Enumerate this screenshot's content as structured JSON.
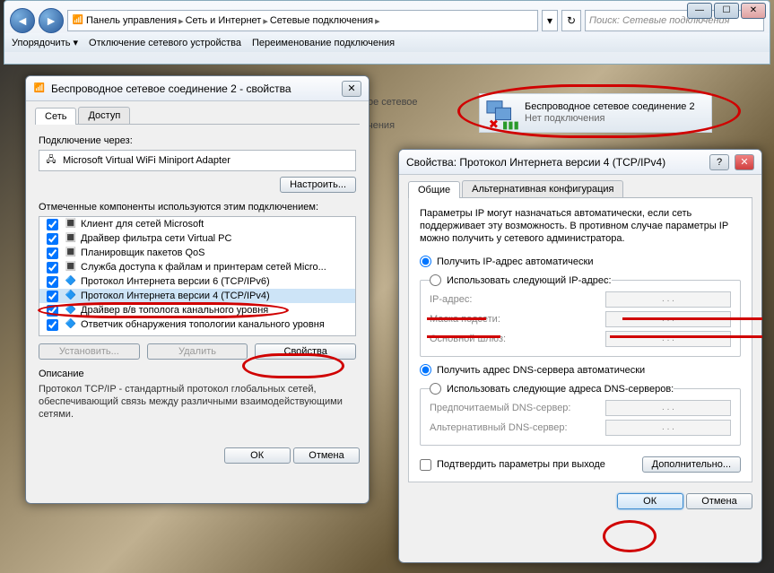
{
  "explorer": {
    "breadcrumb": [
      "Панель управления",
      "Сеть и Интернет",
      "Сетевые подключения"
    ],
    "search_placeholder": "Поиск: Сетевые подключения",
    "toolbar": {
      "organize": "Упорядочить",
      "disable": "Отключение сетевого устройства",
      "rename": "Переименование подключения"
    }
  },
  "bg_items": {
    "item1_line1": "ое сетевое",
    "item1_line2": "чения"
  },
  "connection": {
    "name": "Беспроводное сетевое соединение 2",
    "status": "Нет подключения"
  },
  "props_dialog": {
    "title": "Беспроводное сетевое соединение 2 - свойства",
    "tabs": {
      "network": "Сеть",
      "access": "Доступ"
    },
    "connect_via": "Подключение через:",
    "adapter": "Microsoft Virtual WiFi Miniport Adapter",
    "configure": "Настроить...",
    "components_label": "Отмеченные компоненты используются этим подключением:",
    "components": [
      "Клиент для сетей Microsoft",
      "Драйвер фильтра сети Virtual PC",
      "Планировщик пакетов QoS",
      "Служба доступа к файлам и принтерам сетей Micro...",
      "Протокол Интернета версии 6 (TCP/IPv6)",
      "Протокол Интернета версии 4 (TCP/IPv4)",
      "Драйвер в/в тополога канального уровня",
      "Ответчик обнаружения топологии канального уровня"
    ],
    "install": "Установить...",
    "remove": "Удалить",
    "properties": "Свойства",
    "description_label": "Описание",
    "description": "Протокол TCP/IP - стандартный протокол глобальных сетей, обеспечивающий связь между различными взаимодействующими сетями.",
    "ok": "ОК",
    "cancel": "Отмена"
  },
  "ip_dialog": {
    "title": "Свойства: Протокол Интернета версии 4 (TCP/IPv4)",
    "tabs": {
      "general": "Общие",
      "alt": "Альтернативная конфигурация"
    },
    "intro": "Параметры IP могут назначаться автоматически, если сеть поддерживает эту возможность. В противном случае параметры IP можно получить у сетевого администратора.",
    "auto_ip": "Получить IP-адрес автоматически",
    "use_ip": "Использовать следующий IP-адрес:",
    "ip_address": "IP-адрес:",
    "mask": "Маска подсети:",
    "gateway": "Основной шлюз:",
    "dot_placeholder": ".     .     .",
    "auto_dns": "Получить адрес DNS-сервера автоматически",
    "use_dns": "Использовать следующие адреса DNS-серверов:",
    "pref_dns": "Предпочитаемый DNS-сервер:",
    "alt_dns": "Альтернативный DNS-сервер:",
    "confirm_exit": "Подтвердить параметры при выходе",
    "advanced": "Дополнительно...",
    "ok": "ОК",
    "cancel": "Отмена"
  }
}
